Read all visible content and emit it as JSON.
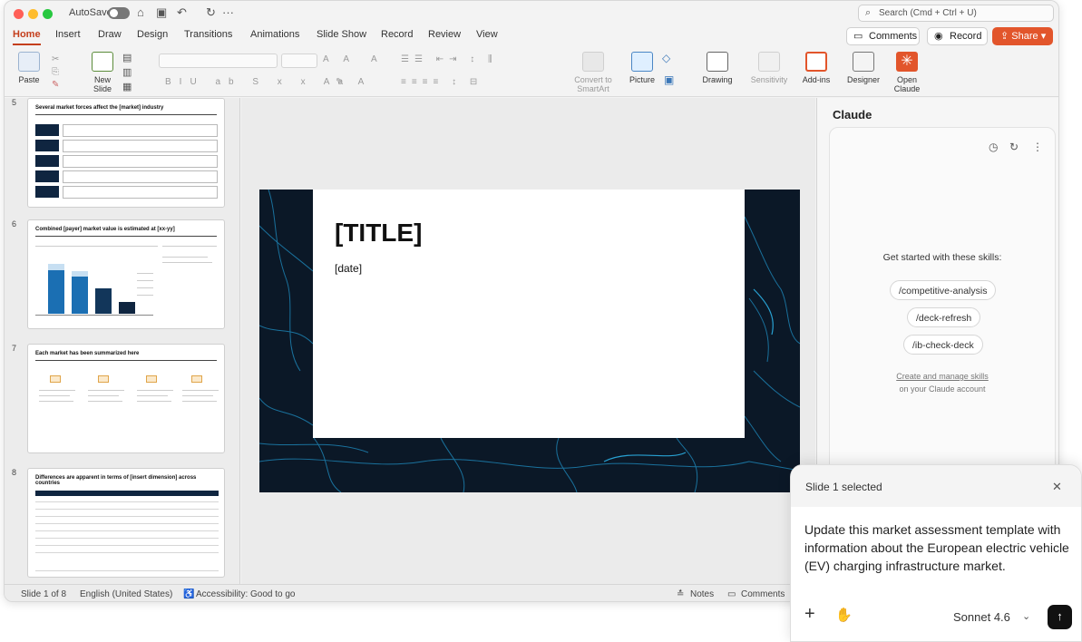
{
  "titlebar": {
    "autosave_label": "AutoSave",
    "search_placeholder": "Search (Cmd + Ctrl + U)"
  },
  "tabs": [
    "Home",
    "Insert",
    "Draw",
    "Design",
    "Transitions",
    "Animations",
    "Slide Show",
    "Record",
    "Review",
    "View"
  ],
  "header_buttons": {
    "comments": "Comments",
    "record": "Record",
    "share": "Share"
  },
  "ribbon": {
    "paste": "Paste",
    "new_slide_1": "New",
    "new_slide_2": "Slide",
    "convert_1": "Convert to",
    "convert_2": "SmartArt",
    "picture": "Picture",
    "drawing": "Drawing",
    "sensitivity": "Sensitivity",
    "addins": "Add-ins",
    "designer": "Designer",
    "open_claude_1": "Open",
    "open_claude_2": "Claude"
  },
  "thumbnails": [
    {
      "num": "5",
      "title": "Several market forces affect the [market] industry",
      "kind": "forces"
    },
    {
      "num": "6",
      "title": "Combined [payer] market value is estimated at [xx-yy]",
      "kind": "chart"
    },
    {
      "num": "7",
      "title": "Each market has been summarized here",
      "kind": "icons"
    },
    {
      "num": "8",
      "title": "Differences are apparent in terms of [insert dimension] across countries",
      "kind": "table"
    }
  ],
  "slide": {
    "title": "[TITLE]",
    "date": "[date]"
  },
  "claude_pane": {
    "title": "Claude",
    "skills_heading": "Get started with these skills:",
    "skills": [
      "/competitive-analysis",
      "/deck-refresh",
      "/ib-check-deck"
    ],
    "manage_link": "Create and manage skills",
    "manage_sub": "on your Claude account"
  },
  "status": {
    "slide": "Slide 1 of 8",
    "language": "English (United States)",
    "accessibility": "Accessibility: Good to go",
    "notes": "Notes",
    "comments": "Comments"
  },
  "popup": {
    "title": "Slide 1 selected",
    "message": "Update this market assessment template with information about the European electric vehicle (EV) charging infrastructure market.",
    "model": "Sonnet 4.6"
  },
  "colors": {
    "accent": "#c43e1c",
    "share": "#e2552b",
    "slide_bg": "#0b1827",
    "map_lines": "#1f8fc4"
  }
}
